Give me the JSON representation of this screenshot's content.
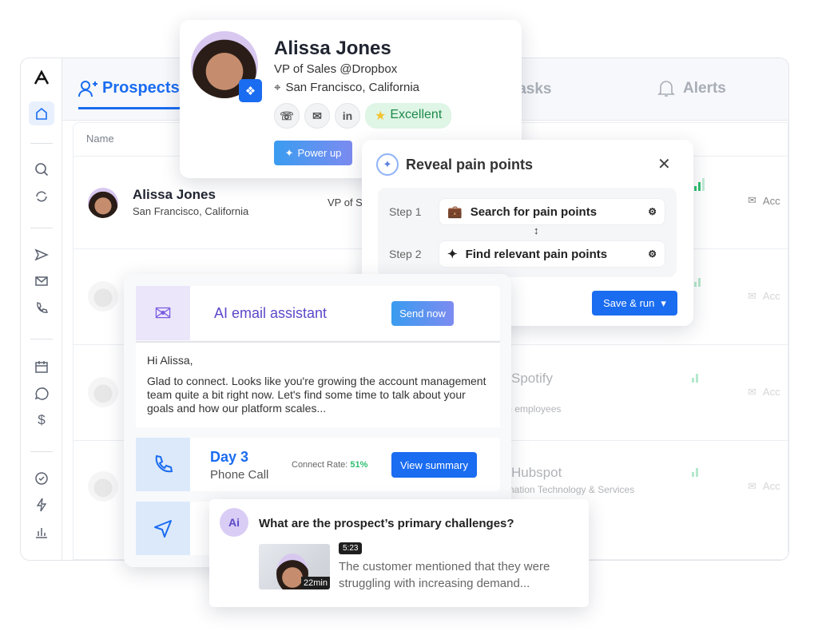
{
  "sidebar": {
    "items": [
      "logo",
      "home",
      "search",
      "sync",
      "send",
      "mail",
      "phone",
      "calendar",
      "chat",
      "dollar",
      "check",
      "bolt",
      "chart"
    ]
  },
  "tabs": {
    "prospects": "Prospects",
    "tasks": "Tasks",
    "alerts": "Alerts"
  },
  "table": {
    "header_name": "Name",
    "rows": [
      {
        "name": "Alissa Jones",
        "location": "San Francisco, California",
        "title": "VP of S",
        "email_status": "Acc"
      },
      {
        "email_status": "Acc"
      },
      {
        "company": "Spotify",
        "detail": ") employees",
        "email_status": "Acc"
      },
      {
        "company": "Hubspot",
        "detail": "nation Technology & Services",
        "email_status": "Acc"
      }
    ]
  },
  "profile": {
    "name": "Alissa Jones",
    "title": "VP of Sales @Dropbox",
    "location": "San Francisco, California",
    "badge": "Excellent",
    "linkedin": "in",
    "power_up": "Power up"
  },
  "pain": {
    "title": "Reveal pain points",
    "steps": [
      {
        "label": "Step 1",
        "action": "Search for pain points"
      },
      {
        "label": "Step 2",
        "action": "Find relevant pain points"
      }
    ],
    "save_run": "Save & run"
  },
  "email": {
    "title": "AI email assistant",
    "send_now": "Send now",
    "greeting": "Hi Alissa,",
    "body": "Glad to connect. Looks like you're growing the account management team quite a bit right now. Let's find some time to talk about your goals and how our platform scales..."
  },
  "call": {
    "day": "Day 3",
    "type": "Phone Call",
    "connect_label": "Connect Rate:",
    "connect_rate": "51%",
    "view_summary": "View summary"
  },
  "question": {
    "text": "What are the prospect’s primary challenges?",
    "timestamp": "5:23",
    "duration": "22min",
    "answer": "The customer mentioned that they were struggling with increasing demand..."
  },
  "colors": {
    "primary": "#1a6cf0",
    "accent_purple": "#6c4fd8",
    "green": "#2fbf71"
  }
}
